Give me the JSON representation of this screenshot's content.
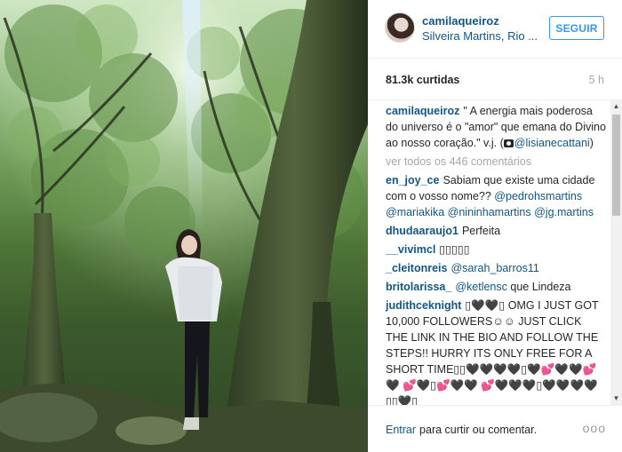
{
  "post": {
    "username": "camilaqueiroz",
    "location": "Silveira Martins, Rio ...",
    "follow_label": "SEGUIR",
    "likes": "81.3k curtidas",
    "time": "5 h"
  },
  "caption": {
    "username": "camilaqueiroz",
    "text": "\" A energia mais poderosa do universo é o \"amor\" que emana do Divino ao nosso coração.\" v.j. (",
    "mention": "@lisianecattani",
    "close": ")"
  },
  "view_all": "ver todos os 446 comentários",
  "comments": [
    {
      "username": "en_joy_ce",
      "text": "Sabiam que existe uma cidade com o vosso nome??",
      "mentions": "@pedrohsmartins @mariakika @nininhamartins @jg.martins"
    },
    {
      "username": "dhudaaraujo1",
      "text": "Perfeita"
    },
    {
      "username": "__vivimcl",
      "text": "▯▯▯▯▯"
    },
    {
      "username": "_cleitonreis",
      "mention": "@sarah_barros11"
    },
    {
      "username": "britolarissa_",
      "mention": "@ketlensc",
      "text": "que Lindeza"
    },
    {
      "username": "judithceknight",
      "text": "▯🖤🖤▯ OMG I JUST GOT 10,000 FOLLOWERS☺☺ JUST CLICK THE LINK IN THE BIO AND FOLLOW THE STEPS!! HURRY ITS ONLY FREE FOR A SHORT TIME▯▯🖤🖤🖤🖤▯🖤💕🖤🖤💕🖤 💕🖤▯💕🖤🖤 💕🖤🖤🖤▯🖤🖤🖤🖤▯▯🖤▯"
    }
  ],
  "footer": {
    "login_label": "Entrar",
    "login_text": "para curtir ou comentar.",
    "more_label": "ooo"
  },
  "icons": {
    "camera": "camera-icon",
    "more": "more-options-icon",
    "scroll_up": "arrow-up-icon",
    "scroll_down": "arrow-down-icon"
  },
  "colors": {
    "link": "#125688",
    "follow": "#3897f0",
    "muted": "#a5a7aa"
  }
}
